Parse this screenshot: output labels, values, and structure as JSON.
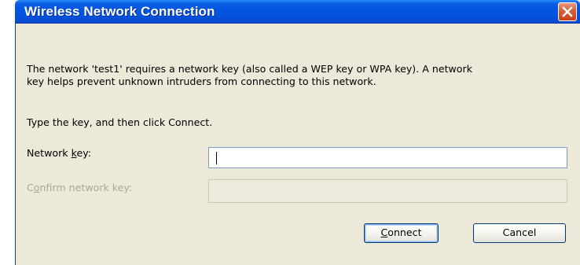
{
  "window": {
    "title": "Wireless Network Connection"
  },
  "message": {
    "line1": "The network 'test1' requires a network key (also called a WEP key or WPA key). A network",
    "line2": "key helps prevent unknown intruders from connecting to this network.",
    "instruction": "Type the key, and then click Connect."
  },
  "fields": {
    "network_key": {
      "label_before": "Network ",
      "label_accel": "k",
      "label_after": "ey:",
      "value": ""
    },
    "confirm_key": {
      "label_before": "C",
      "label_accel": "o",
      "label_after": "nfirm network key:",
      "value": "",
      "disabled": true
    }
  },
  "buttons": {
    "connect": {
      "accel": "C",
      "rest": "onnect"
    },
    "cancel": {
      "label": "Cancel"
    }
  },
  "icons": {
    "close": "close-icon"
  },
  "colors": {
    "titlebar": "#0355e0",
    "close_button": "#d9613c",
    "dialog_background": "#ece9d8"
  }
}
